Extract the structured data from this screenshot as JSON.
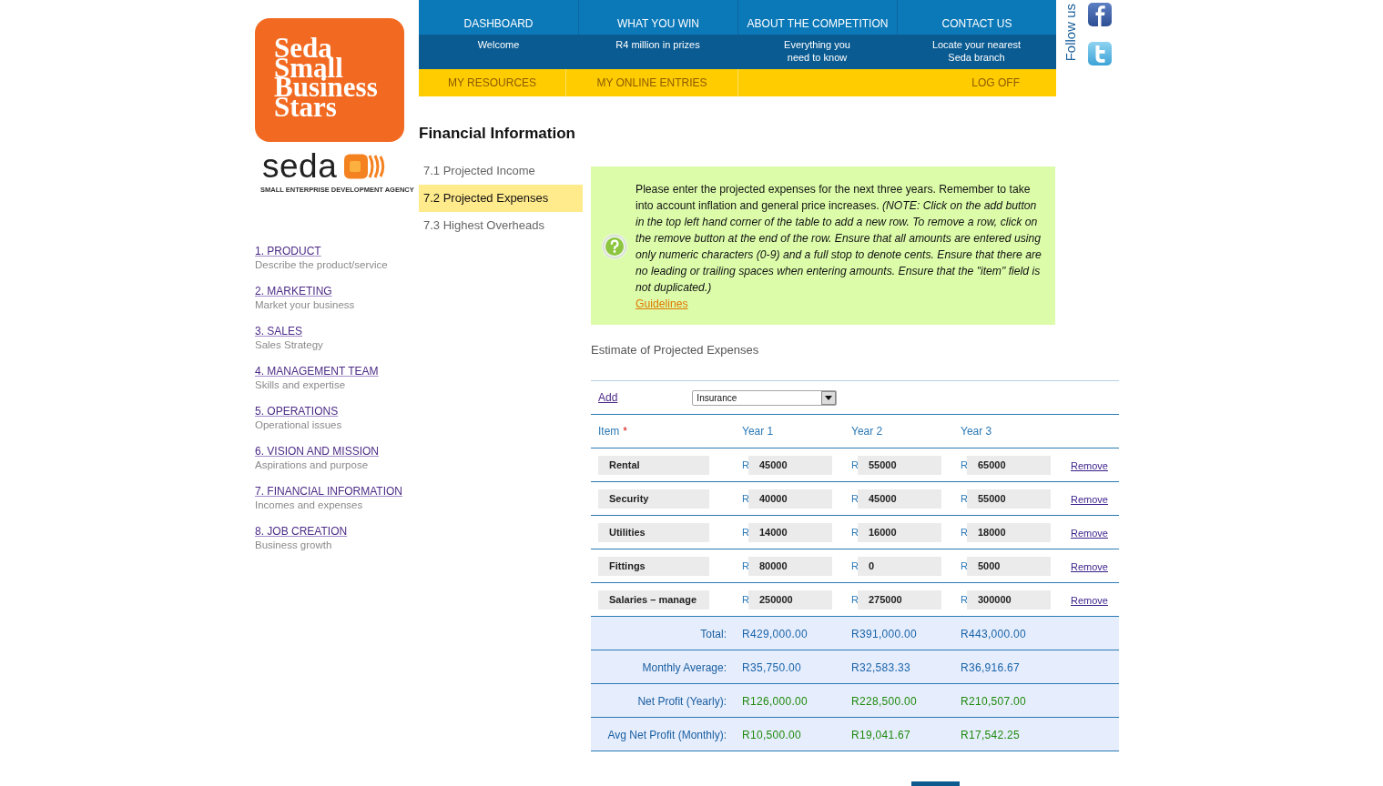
{
  "logo": {
    "lines": [
      "Seda",
      "Small",
      "Business",
      "Stars"
    ]
  },
  "agency": {
    "wordmark": "seda",
    "name": "SMALL ENTERPRISE DEVELOPMENT AGENCY"
  },
  "sections": [
    {
      "title": "1. PRODUCT",
      "subtitle": "Describe the product/service"
    },
    {
      "title": "2. MARKETING",
      "subtitle": "Market your business"
    },
    {
      "title": "3. SALES",
      "subtitle": "Sales Strategy"
    },
    {
      "title": "4. MANAGEMENT TEAM",
      "subtitle": "Skills and expertise"
    },
    {
      "title": "5. OPERATIONS",
      "subtitle": "Operational issues"
    },
    {
      "title": "6. VISION AND MISSION",
      "subtitle": "Aspirations and purpose"
    },
    {
      "title": "7. FINANCIAL INFORMATION",
      "subtitle": "Incomes and expenses"
    },
    {
      "title": "8. JOB CREATION",
      "subtitle": "Business growth"
    }
  ],
  "top_nav": [
    {
      "label": "DASHBOARD",
      "subtitle": "Welcome"
    },
    {
      "label": "WHAT YOU WIN",
      "subtitle": "R4 million in prizes"
    },
    {
      "label": "ABOUT THE COMPETITION",
      "subtitle": "Everything you\nneed to know"
    },
    {
      "label": "CONTACT US",
      "subtitle": "Locate your nearest\nSeda branch"
    }
  ],
  "menu": [
    "MY RESOURCES",
    "MY ONLINE ENTRIES",
    "LOG OFF"
  ],
  "social": {
    "label": "Follow us"
  },
  "page_title": "Financial Information",
  "subsections": [
    {
      "label": "7.1 Projected Income",
      "selected": false
    },
    {
      "label": "7.2 Projected Expenses",
      "selected": true
    },
    {
      "label": "7.3 Highest Overheads",
      "selected": false
    }
  ],
  "info": {
    "text": "Please enter the projected expenses for the next three years. Remember to take into account inflation and general price increases. *(NOTE: Click on the add button in the top left hand corner of the table to add a new row. To remove a row, click on the remove button at the end of the row. Ensure that all amounts are entered using only numeric characters (0-9) and a full stop to denote cents. Ensure that there are no leading or trailing spaces when entering amounts. Ensure that the \"item\" field is not duplicated.)*",
    "link": "Guidelines"
  },
  "expenses": {
    "title": "Estimate of Projected Expenses",
    "add_link": "Add",
    "category": "Insurance",
    "columns": [
      "Item",
      "Year 1",
      "Year 2",
      "Year 3"
    ],
    "required_mark": "*",
    "rows": [
      {
        "item": "Rental",
        "amounts": [
          {
            "currency": "R",
            "value": "45000"
          },
          {
            "currency": "R",
            "value": "55000"
          },
          {
            "currency": "R",
            "value": "65000"
          }
        ],
        "action": "Remove"
      },
      {
        "item": "Security",
        "amounts": [
          {
            "currency": "R",
            "value": "40000"
          },
          {
            "currency": "R",
            "value": "45000"
          },
          {
            "currency": "R",
            "value": "55000"
          }
        ],
        "action": "Remove"
      },
      {
        "item": "Utilities",
        "amounts": [
          {
            "currency": "R",
            "value": "14000"
          },
          {
            "currency": "R",
            "value": "16000"
          },
          {
            "currency": "R",
            "value": "18000"
          }
        ],
        "action": "Remove"
      },
      {
        "item": "Fittings",
        "amounts": [
          {
            "currency": "R",
            "value": "80000"
          },
          {
            "currency": "R",
            "value": "0"
          },
          {
            "currency": "R",
            "value": "5000"
          }
        ],
        "action": "Remove"
      },
      {
        "item": "Salaries – manage",
        "amounts": [
          {
            "currency": "R",
            "value": "250000"
          },
          {
            "currency": "R",
            "value": "275000"
          },
          {
            "currency": "R",
            "value": "300000"
          }
        ],
        "action": "Remove"
      }
    ],
    "summary": [
      {
        "label": "Total:",
        "kind": "total",
        "values": [
          "R429,000.00",
          "R391,000.00",
          "R443,000.00"
        ]
      },
      {
        "label": "Monthly Average:",
        "kind": "total",
        "values": [
          "R35,750.00",
          "R32,583.33",
          "R36,916.67"
        ]
      },
      {
        "label": "Net Profit (Yearly):",
        "kind": "profit",
        "values": [
          "R126,000.00",
          "R228,500.00",
          "R210,507.00"
        ]
      },
      {
        "label": "Avg Net Profit (Monthly):",
        "kind": "profit",
        "values": [
          "R10,500.00",
          "R19,041.67",
          "R17,542.25"
        ]
      }
    ]
  }
}
